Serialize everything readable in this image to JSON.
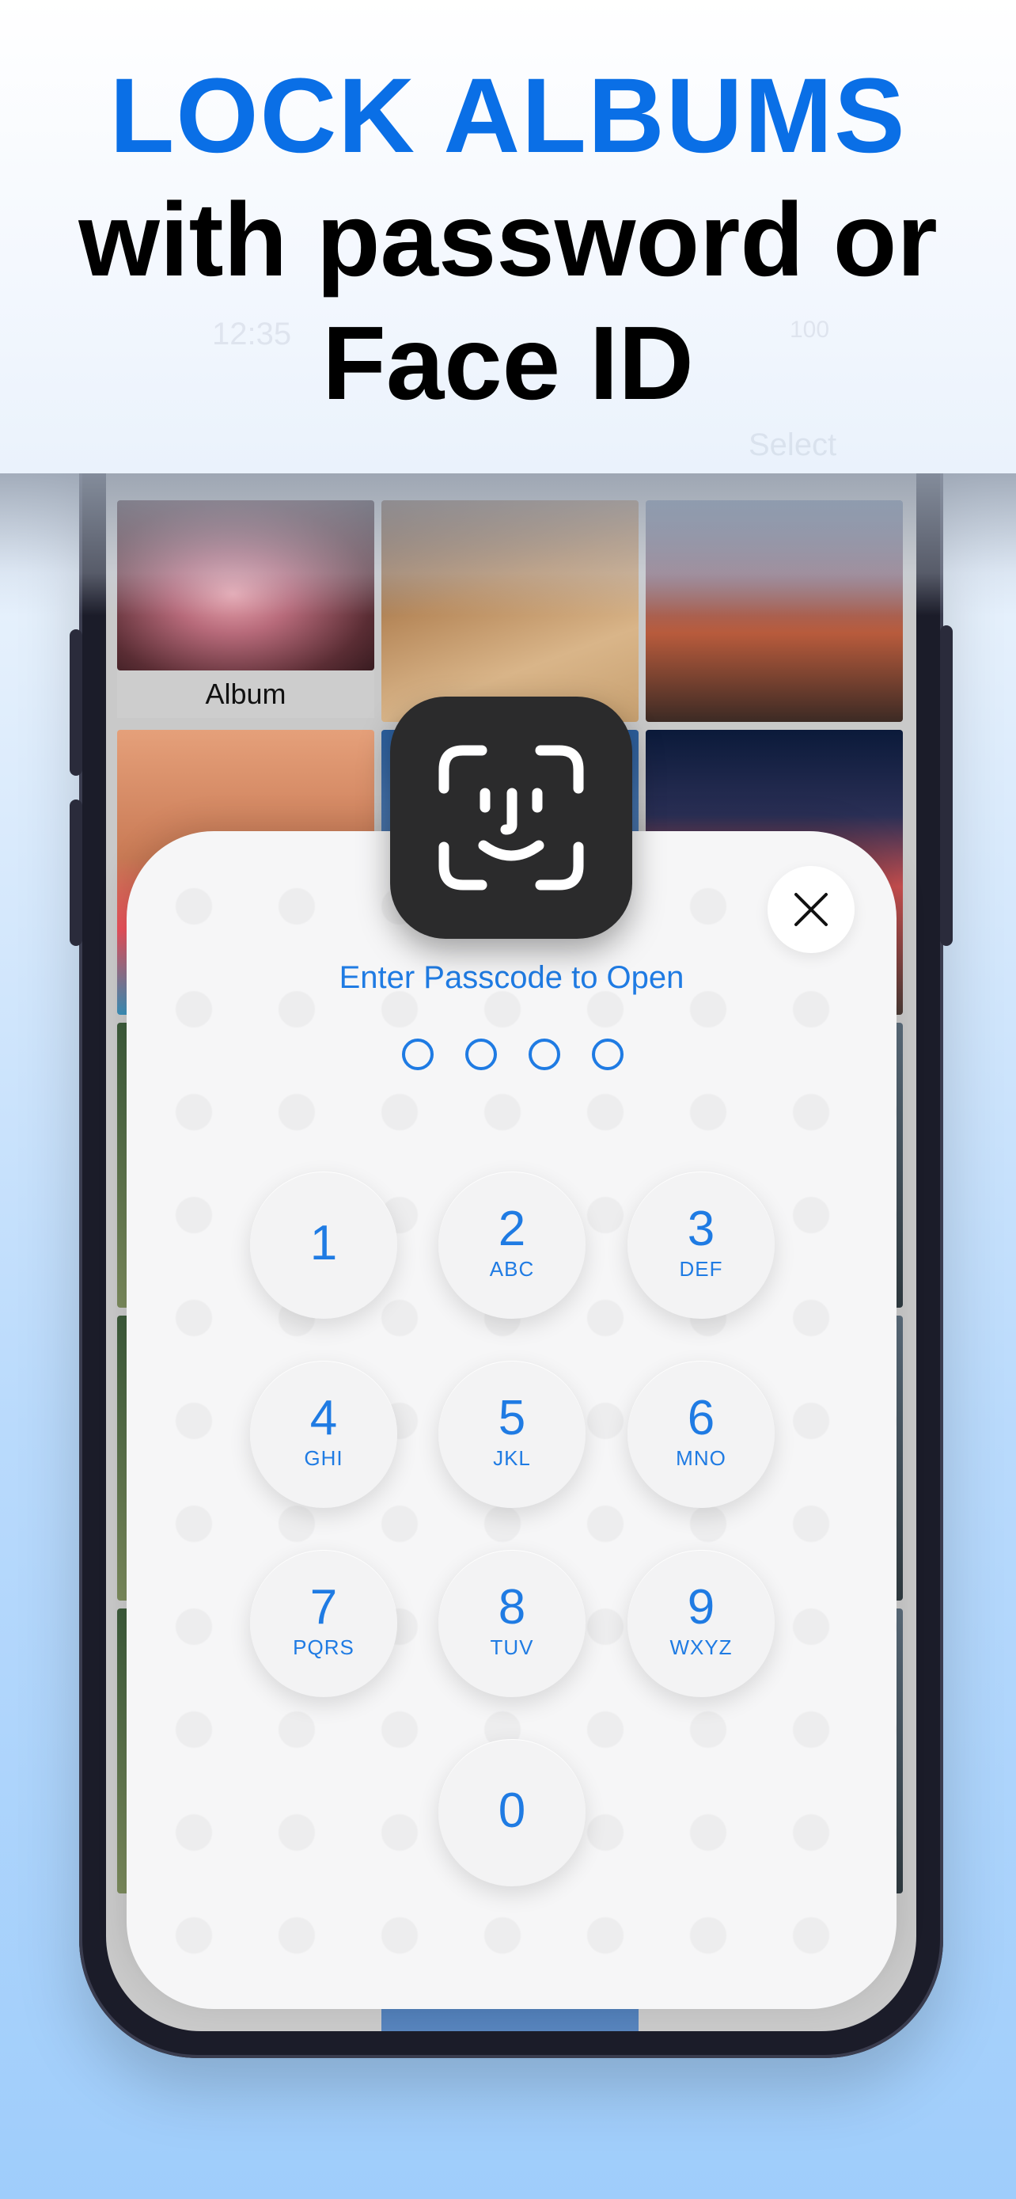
{
  "headline": {
    "line1": "LOCK ALBUMS",
    "line2": "with password or",
    "line3": "Face ID"
  },
  "status_bar": {
    "time": "12:35",
    "battery": "100"
  },
  "nav": {
    "select_label": "Select"
  },
  "album": {
    "label": "Album"
  },
  "passcode": {
    "prompt": "Enter Passcode to Open",
    "entered_digits": 0,
    "total_digits": 4,
    "keys": [
      {
        "num": "1",
        "letters": ""
      },
      {
        "num": "2",
        "letters": "ABC"
      },
      {
        "num": "3",
        "letters": "DEF"
      },
      {
        "num": "4",
        "letters": "GHI"
      },
      {
        "num": "5",
        "letters": "JKL"
      },
      {
        "num": "6",
        "letters": "MNO"
      },
      {
        "num": "7",
        "letters": "PQRS"
      },
      {
        "num": "8",
        "letters": "TUV"
      },
      {
        "num": "9",
        "letters": "WXYZ"
      },
      {
        "num": "0",
        "letters": ""
      }
    ]
  },
  "icons": {
    "close": "close-icon",
    "faceid": "face-id-icon"
  },
  "colors": {
    "accent": "#1f7be3",
    "headline_blue": "#0a6fe6",
    "headline_black": "#000000",
    "faceid_bg": "#2b2b2c"
  }
}
